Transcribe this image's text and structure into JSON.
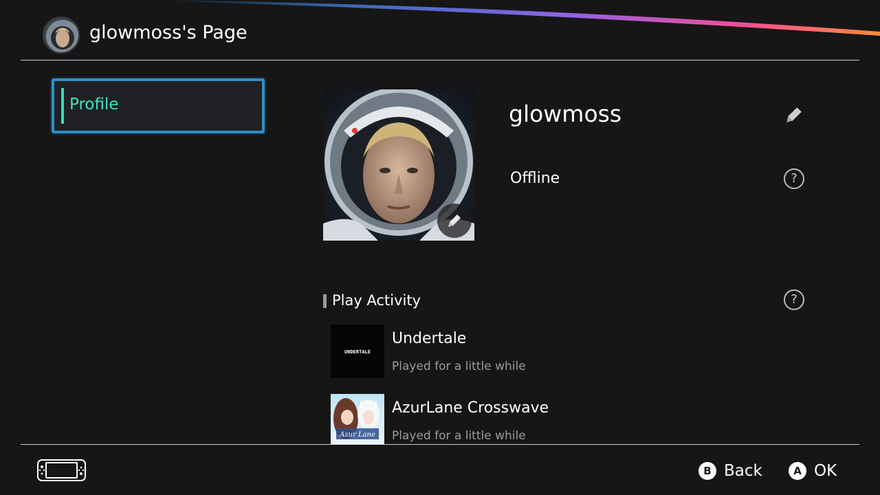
{
  "header": {
    "title": "glowmoss's Page",
    "avatar_icon": "astronaut-avatar"
  },
  "sidebar": {
    "items": [
      {
        "label": "Profile",
        "selected": true
      }
    ]
  },
  "profile": {
    "username": "glowmoss",
    "status": "Offline",
    "picture_icon": "astronaut-portrait",
    "edit_icon": "pencil-icon",
    "help_icon": "question-mark-icon"
  },
  "play_activity": {
    "title": "Play Activity",
    "games": [
      {
        "title": "Undertale",
        "playtime": "Played for a little while",
        "thumb_text": "UNDERTALE"
      },
      {
        "title": "AzurLane Crosswave",
        "playtime": "Played for a little while",
        "thumb_text": "Azur Lane"
      }
    ]
  },
  "footer": {
    "console_icon": "switch-console-icon",
    "buttons": [
      {
        "key": "B",
        "label": "Back"
      },
      {
        "key": "A",
        "label": "OK"
      }
    ]
  },
  "colors": {
    "accent": "#2fe0b9",
    "selection_border": "#2d8fc7",
    "background": "#161617"
  }
}
